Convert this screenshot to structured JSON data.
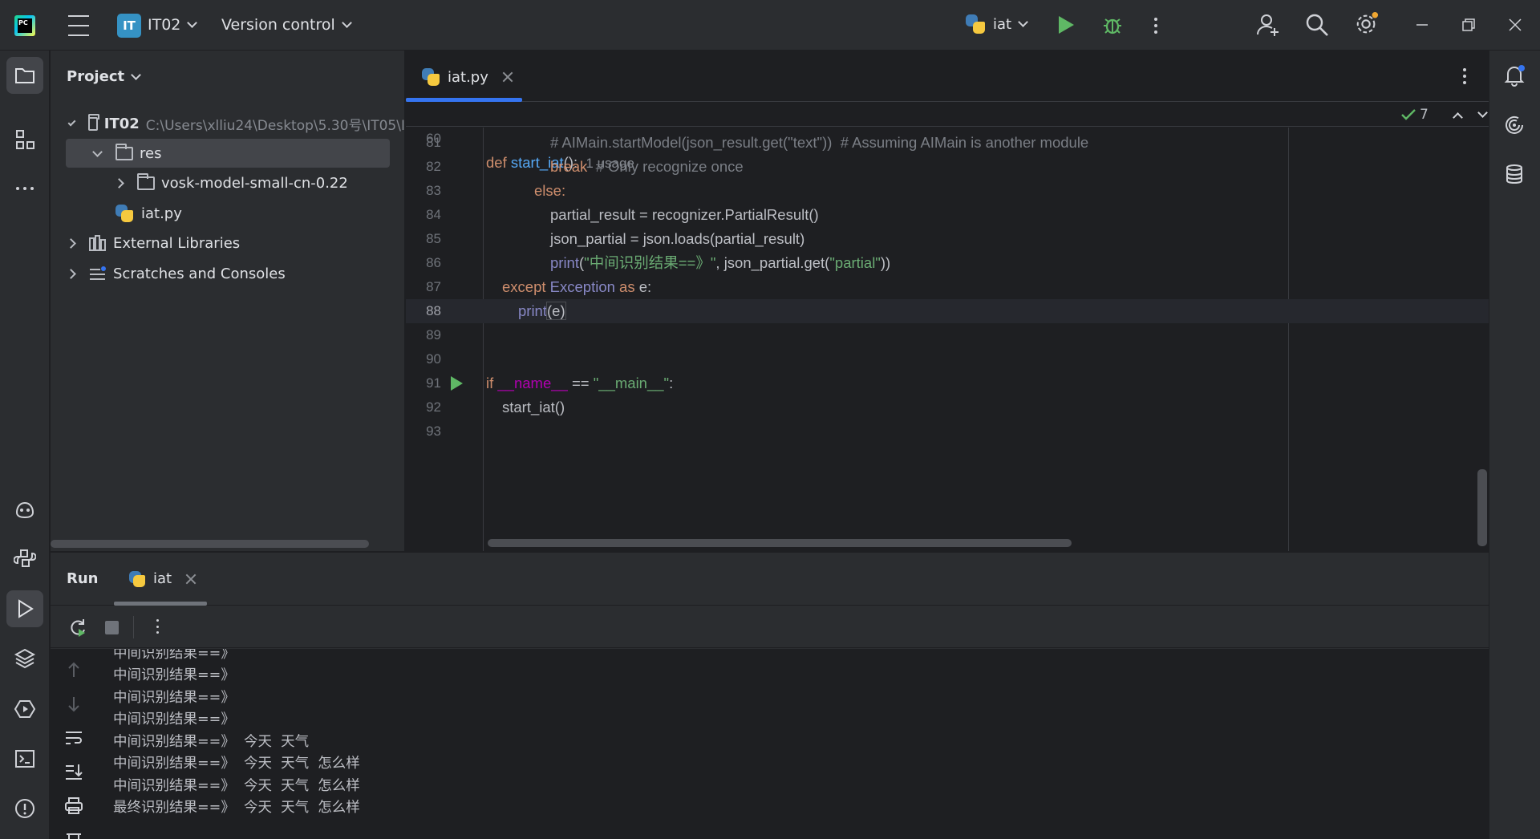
{
  "titlebar": {
    "logo_text": "PC",
    "project_badge": "IT",
    "project_name": "IT02",
    "vcs_label": "Version control",
    "run_config": "iat"
  },
  "project_panel": {
    "title": "Project",
    "tree": {
      "root_name": "IT02",
      "root_path": "C:\\Users\\xlliu24\\Desktop\\5.30号\\IT05\\I",
      "res": "res",
      "vosk": "vosk-model-small-cn-0.22",
      "iat_file": "iat.py",
      "external_libraries": "External Libraries",
      "scratches": "Scratches and Consoles"
    }
  },
  "editor": {
    "tab_label": "iat.py",
    "sticky": {
      "line": "60",
      "text_kw": "def",
      "text_fn": "start_iat",
      "text_rest": "():",
      "hint": "1 usage"
    },
    "inspection_count": "7",
    "lines": [
      {
        "n": "81"
      },
      {
        "n": "82"
      },
      {
        "n": "83"
      },
      {
        "n": "84"
      },
      {
        "n": "85"
      },
      {
        "n": "86"
      },
      {
        "n": "87"
      },
      {
        "n": "88"
      },
      {
        "n": "89"
      },
      {
        "n": "90"
      },
      {
        "n": "91"
      },
      {
        "n": "92"
      },
      {
        "n": "93"
      }
    ],
    "code": {
      "l81": "# AIMain.startModel(json_result.get(\"text\"))  # Assuming AIMain is another module",
      "l82_kw": "break",
      "l82_cm": "# Only recognize once",
      "l83": "else:",
      "l84": "partial_result = recognizer.PartialResult()",
      "l85": "json_partial = json.loads(partial_result)",
      "l86_fn": "print",
      "l86_a": "(",
      "l86_str": "\"中间识别结果==》\"",
      "l86_b": ", json_partial.get(",
      "l86_str2": "\"partial\"",
      "l86_c": "))",
      "l87_kw": "except",
      "l87_cls": "Exception",
      "l87_as": "as",
      "l87_rest": "e:",
      "l88_fn": "print",
      "l88_rest": "(e)",
      "l91_kw": "if",
      "l91_name": "__name__",
      "l91_op": "==",
      "l91_str": "\"__main__\"",
      "l91_colon": ":",
      "l92": "start_iat()"
    }
  },
  "run_panel": {
    "title": "Run",
    "tab_label": "iat",
    "output": [
      "中间识别结果==》",
      "中间识别结果==》",
      "中间识别结果==》",
      "中间识别结果==》",
      "中间识别结果==》  今天  天气",
      "中间识别结果==》  今天  天气  怎么样",
      "中间识别结果==》  今天  天气  怎么样",
      "最终识别结果==》  今天  天气  怎么样"
    ]
  },
  "colors": {
    "accent": "#3574f0",
    "run_green": "#5fb865",
    "keyword": "#cf8e6d",
    "string": "#6aab73",
    "function": "#56a8f5"
  }
}
